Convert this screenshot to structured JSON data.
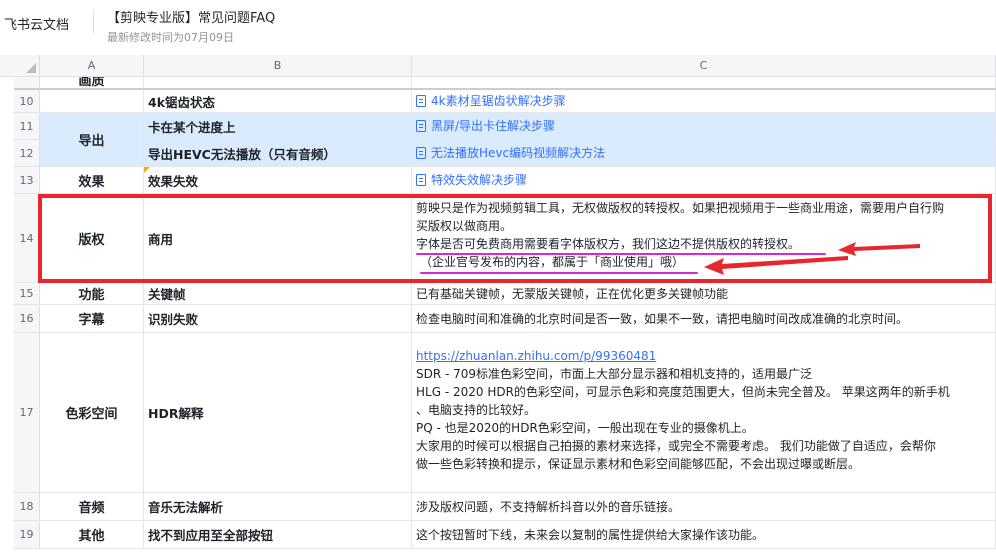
{
  "app": {
    "brand": "飞书云文档",
    "title": "【剪映专业版】常见问题FAQ",
    "last_modified": "最新修改时间为07月09日"
  },
  "columns": [
    "A",
    "B",
    "C"
  ],
  "rows": [
    {
      "num": "",
      "a": "画质",
      "b": "",
      "c": ""
    },
    {
      "num": "10",
      "a": "",
      "b": "4k锯齿状态",
      "c": "4k素材呈锯齿状解决步骤"
    },
    {
      "num": "11",
      "a": "导出",
      "b": "卡在某个进度上",
      "c": "黑屏/导出卡住解决步骤"
    },
    {
      "num": "12",
      "a": "",
      "b": "导出HEVC无法播放（只有音频）",
      "c": "无法播放Hevc编码视频解决方法"
    },
    {
      "num": "13",
      "a": "效果",
      "b": "效果失效",
      "c": "特效失效解决步骤"
    },
    {
      "num": "14",
      "a": "版权",
      "b": "商用",
      "c_lines": [
        "剪映只是作为视频剪辑工具，无权做版权的转授权。如果把视频用于一些商业用途，需要用户自行购",
        "买版权以做商用。",
        "字体是否可免费商用需要看字体版权方，我们这边不提供版权的转授权。",
        "（企业官号发布的内容，都属于「商业使用」哦）"
      ]
    },
    {
      "num": "15",
      "a": "功能",
      "b": "关键帧",
      "c": "已有基础关键帧，无蒙版关键帧，正在优化更多关键帧功能"
    },
    {
      "num": "16",
      "a": "字幕",
      "b": "识别失败",
      "c": "检查电脑时间和准确的北京时间是否一致，如果不一致，请把电脑时间改成准确的北京时间。"
    },
    {
      "num": "17",
      "a": "色彩空间",
      "b": "HDR解释",
      "c_url": "https://zhuanlan.zhihu.com/p/99360481",
      "c_lines": [
        "SDR - 709标准色彩空间，市面上大部分显示器和相机支持的，适用最广泛",
        "HLG - 2020 HDR的色彩空间，可显示色彩和亮度范围更大，但尚未完全普及。 苹果这两年的新手机",
        "、电脑支持的比较好。",
        "PQ - 也是2020的HDR色彩空间，一般出现在专业的摄像机上。",
        "大家用的时候可以根据自己拍摄的素材来选择，或完全不需要考虑。 我们功能做了自适应，会帮你",
        "做一些色彩转换和提示，保证显示素材和色彩空间能够匹配，不会出现过曝或断层。"
      ]
    },
    {
      "num": "18",
      "a": "音频",
      "b": "音乐无法解析",
      "c": "涉及版权问题，不支持解析抖音以外的音乐链接。"
    },
    {
      "num": "19",
      "a": "其他",
      "b": "找不到应用至全部按钮",
      "c": "这个按钮暂时下线，未来会以复制的属性提供给大家操作该功能。"
    }
  ],
  "colors": {
    "highlight_row": "#d9ebfc",
    "annotation_box": "#e8262d",
    "annotation_underline": "#d62bd2",
    "link": "#3370ff"
  }
}
